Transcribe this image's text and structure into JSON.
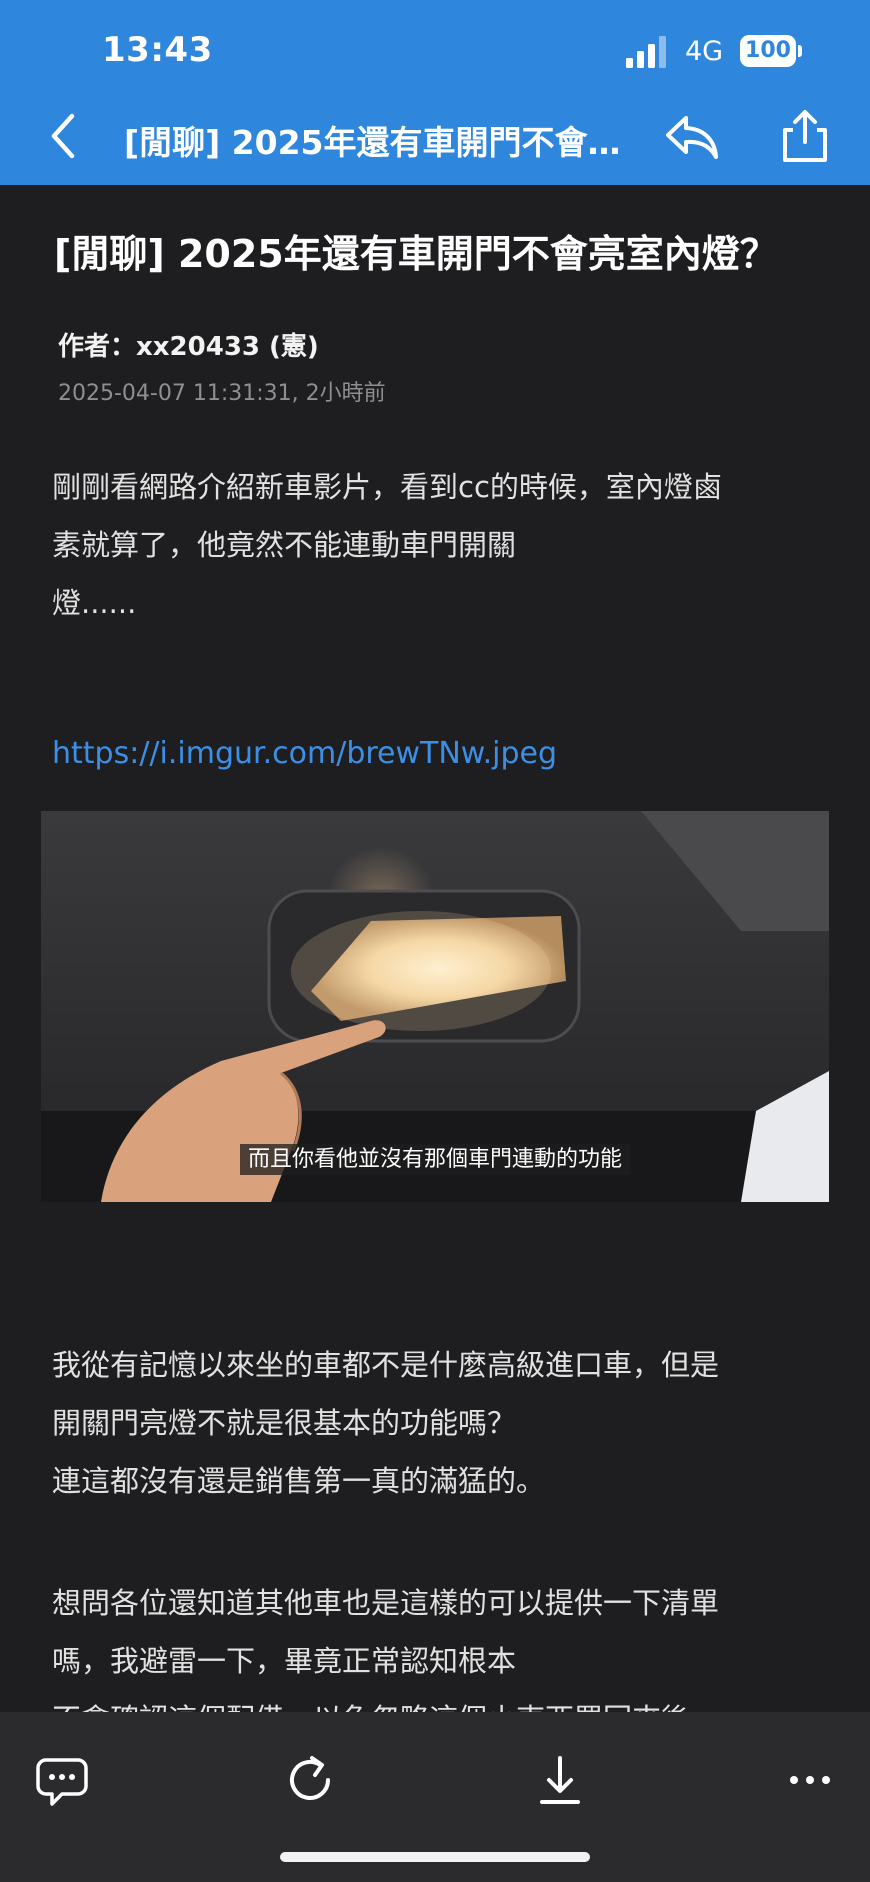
{
  "status_bar": {
    "time": "13:43",
    "network": "4G",
    "battery": "100"
  },
  "nav": {
    "title": "[閒聊] 2025年還有車開門不會亮室內燈？",
    "back_icon": "chevron-left-icon",
    "reply_icon": "reply-icon",
    "share_icon": "share-icon"
  },
  "post": {
    "title": "[閒聊] 2025年還有車開門不會亮室內燈？",
    "author": "作者：xx20433 (憲)",
    "timestamp": "2025-04-07 11:31:31, 2小時前",
    "para1": [
      "剛剛看網路介紹新車影片，看到cc的時候，室內燈鹵",
      "素就算了，他竟然不能連動車門開關",
      "燈......"
    ],
    "link": "https://i.imgur.com/brewTNw.jpeg",
    "image_caption": "而且你看他並沒有那個車門連動的功能",
    "para2": [
      "我從有記憶以來坐的車都不是什麼高級進口車，但是",
      "開關門亮燈不就是很基本的功能嗎？",
      "連這都沒有還是銷售第一真的滿猛的。"
    ],
    "para3": [
      "想問各位還知道其他車也是這樣的可以提供一下清單",
      "嗎，我避雷一下，畢竟正常認知根本",
      "不會確認這個配備，以免忽略這個小東西買回來後"
    ]
  },
  "toolbar": {
    "icons": [
      "comment-icon",
      "refresh-icon",
      "download-icon",
      "more-icon"
    ]
  },
  "colors": {
    "header_blue": "#2f86dd",
    "background": "#1e1e20",
    "link": "#3d8fe6"
  }
}
